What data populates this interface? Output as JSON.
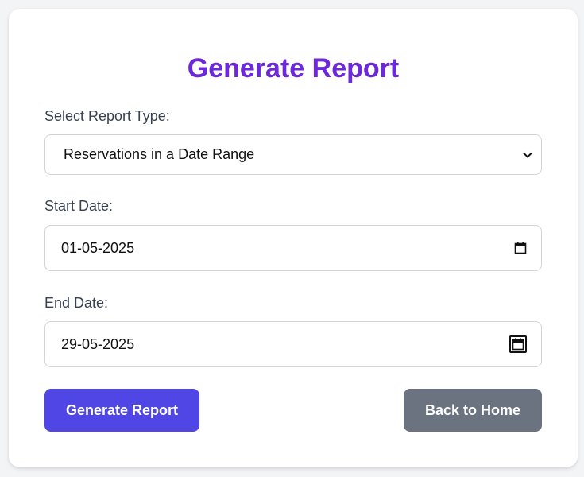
{
  "page": {
    "title": "Generate Report"
  },
  "form": {
    "report_type_label": "Select Report Type:",
    "report_type_value": "Reservations in a Date Range",
    "start_date_label": "Start Date:",
    "start_date_value": "01-05-2025",
    "end_date_label": "End Date:",
    "end_date_value": "29-05-2025"
  },
  "actions": {
    "generate_label": "Generate Report",
    "back_label": "Back to Home"
  },
  "icons": {
    "select": "chevron-down-icon",
    "date": "calendar-icon"
  },
  "colors": {
    "title": "#6d28d9",
    "primary_button": "#4f46e5",
    "secondary_button": "#6b7280",
    "background": "#f3f4f6"
  }
}
